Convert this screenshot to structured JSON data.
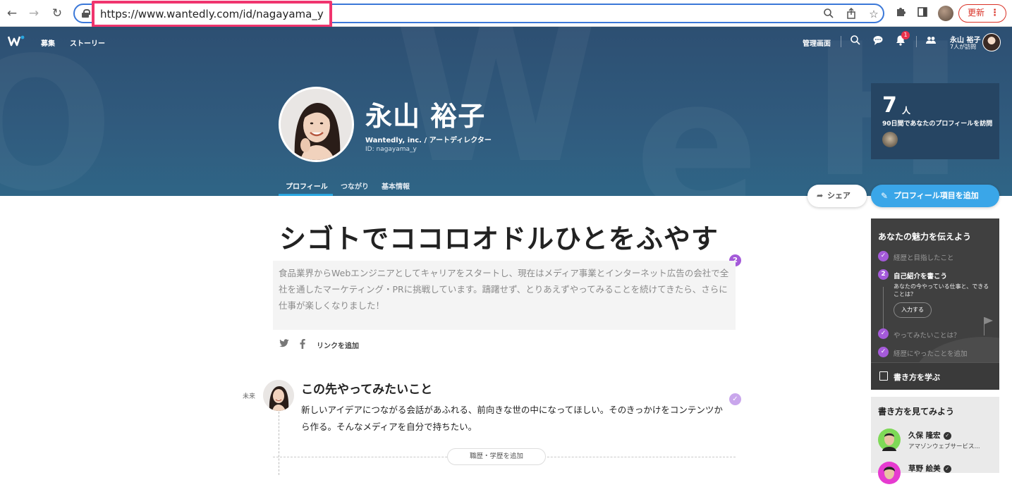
{
  "browser": {
    "url": "https://www.wantedly.com/id/nagayama_y",
    "update_label": "更新",
    "update_menu": "⋮"
  },
  "header": {
    "nav": [
      {
        "label": "募集"
      },
      {
        "label": "ストーリー"
      }
    ],
    "admin_label": "管理画面",
    "notification_count": "1",
    "user_name": "永山 裕子",
    "user_visits": "7人が訪問"
  },
  "profile": {
    "name": "永山 裕子",
    "company": "Wantedly, inc. / アートディレクター",
    "id": "ID: nagayama_y",
    "tabs": [
      {
        "label": "プロフィール"
      },
      {
        "label": "つながり"
      },
      {
        "label": "基本情報"
      }
    ]
  },
  "visits": {
    "count": "7",
    "unit": "人",
    "description": "90日間であなたのプロフィールを訪問"
  },
  "actions": {
    "share": "シェア",
    "add_profile": "プロフィール項目を追加"
  },
  "main": {
    "headline": "シゴトでココロオドルひとをふやす",
    "intro": "食品業界からWebエンジニアとしてキャリアをスタートし、現在はメディア事業とインターネット広告の会社で全社を通したマーケティング・PRに挑戦しています。躊躇せず、とりあえずやってみることを続けてきたら、さらに仕事が楽しくなりました！",
    "intro_badge": "2",
    "add_link": "リンクを追加",
    "future_label": "未来",
    "future_title": "この先やってみたいこと",
    "future_body": "新しいアイデアにつながる会話があふれる、前向きな世の中になってほしい。そのきっかけをコンテンツから作る。そんなメディアを自分で持ちたい。",
    "add_career": "職歴・学歴を追加"
  },
  "tips": {
    "title": "あなたの魅力を伝えよう",
    "items": [
      {
        "label": "経歴と目指したこと"
      },
      {
        "label": "自己紹介を書こう",
        "number": "2",
        "sub": "あなたの今やっている仕事と、できることは？",
        "button": "入力する"
      },
      {
        "label": "やってみたいことは？"
      },
      {
        "label": "経歴にやったことを追加"
      }
    ],
    "footer": "書き方を学ぶ"
  },
  "examples": {
    "title": "書き方を見てみよう",
    "people": [
      {
        "name": "久保 隆宏",
        "company": "アマゾンウェブサービス...",
        "color": "#7ed957"
      },
      {
        "name": "草野 絵美",
        "company": "",
        "color": "#e63bd0"
      }
    ]
  },
  "colors": {
    "accent": "#3aa6e8",
    "purple": "#a45ad9",
    "banner": "#2f5679",
    "highlight": "#f0346e"
  }
}
